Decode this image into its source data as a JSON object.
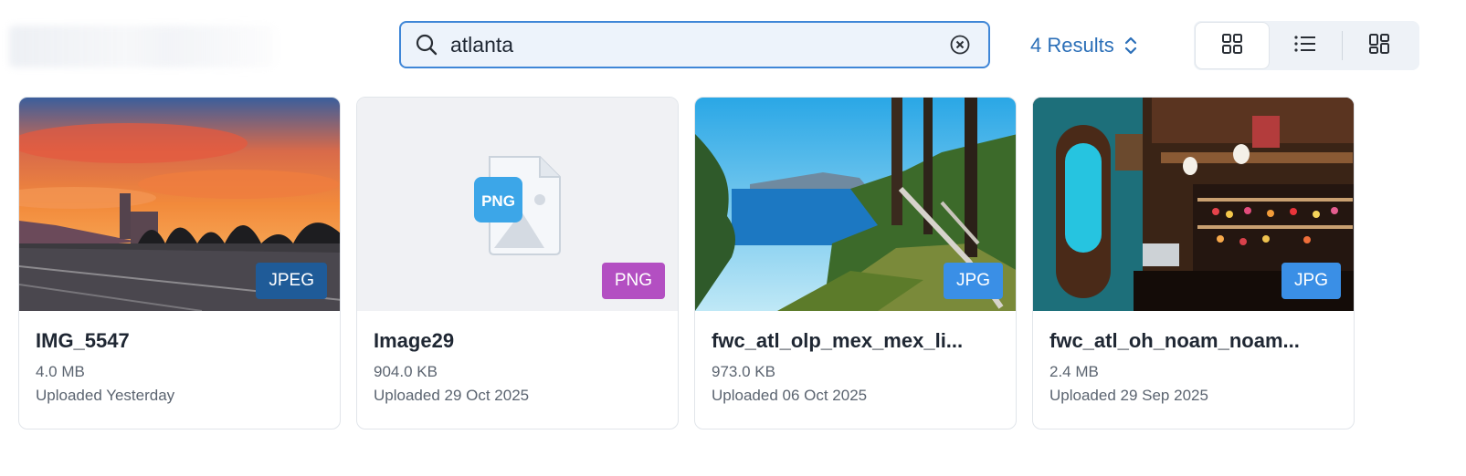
{
  "search": {
    "value": "atlanta",
    "placeholder": ""
  },
  "results": {
    "label": "4 Results"
  },
  "view_modes": [
    {
      "name": "grid",
      "active": true
    },
    {
      "name": "list",
      "active": false
    },
    {
      "name": "masonry",
      "active": false
    }
  ],
  "files": [
    {
      "name": "IMG_5547",
      "size": "4.0 MB",
      "uploaded": "Uploaded Yesterday",
      "type": "JPEG",
      "badge_color": "#1f5b98"
    },
    {
      "name": "Image29",
      "size": "904.0 KB",
      "uploaded": "Uploaded 29 Oct 2025",
      "type": "PNG",
      "badge_color": "#b34fc2",
      "thumbnail_icon": "PNG"
    },
    {
      "name": "fwc_atl_olp_mex_mex_li...",
      "size": "973.0 KB",
      "uploaded": "Uploaded 06 Oct 2025",
      "type": "JPG",
      "badge_color": "#3a8fe6"
    },
    {
      "name": "fwc_atl_oh_noam_noam...",
      "size": "2.4 MB",
      "uploaded": "Uploaded 29 Sep 2025",
      "type": "JPG",
      "badge_color": "#3a8fe6"
    }
  ],
  "colors": {
    "accent": "#3f86d7",
    "link": "#2b6fb8"
  }
}
